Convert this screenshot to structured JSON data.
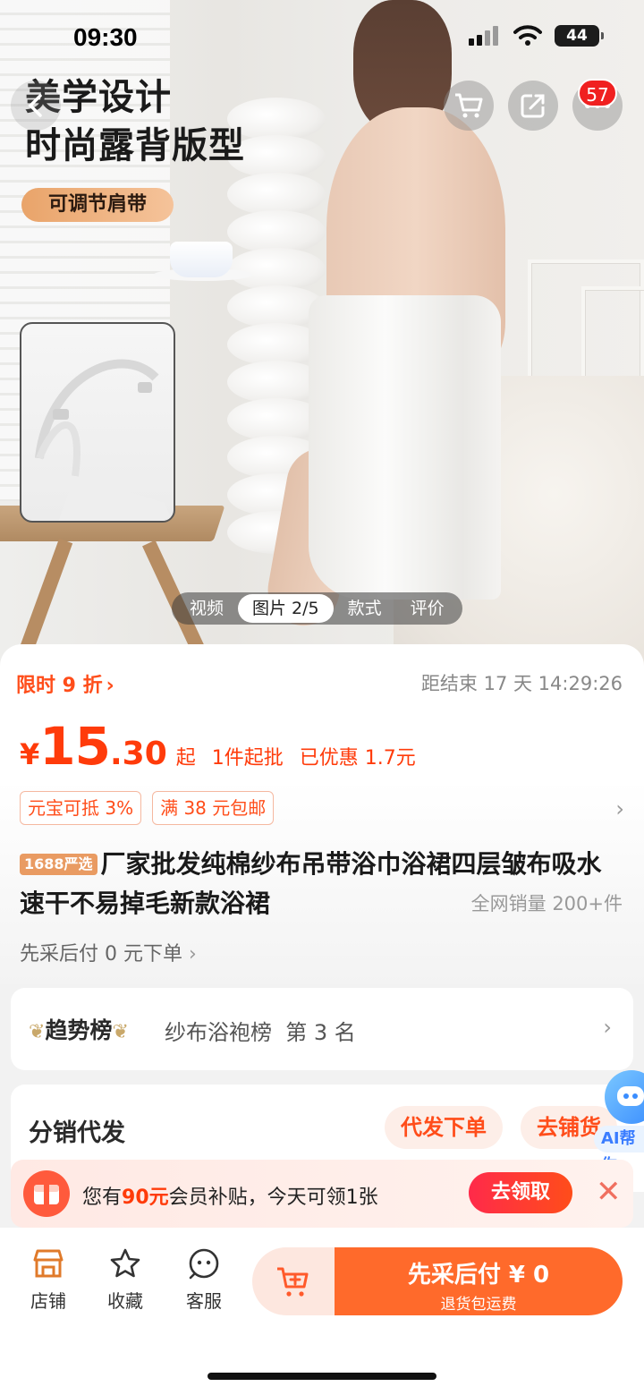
{
  "status_bar": {
    "time": "09:30",
    "battery": "44"
  },
  "hero": {
    "headline_line1": "美学设计",
    "headline_line2": "时尚露背版型",
    "tag": "可调节肩带",
    "cart_badge": "57",
    "media_tabs": [
      "视频",
      "图片 2/5",
      "款式",
      "评价"
    ],
    "active_tab_index": 1
  },
  "promo": {
    "label": "限时 9 折",
    "countdown": "距结束 17 天 14:29:26"
  },
  "price": {
    "currency": "¥",
    "integer": "15",
    "decimal": ".30",
    "suffix": "起",
    "min_order": "1件起批",
    "discount": "已优惠 1.7元"
  },
  "coupons": [
    "元宝可抵 3%",
    "满 38 元包邮"
  ],
  "product": {
    "badge": "1688严选",
    "title": "厂家批发纯棉纱布吊带浴巾浴裙四层皱布吸水速干不易掉毛新款浴裙",
    "sales": "全网销量 200+件",
    "pay_later": "先采后付 0 元下单"
  },
  "trend": {
    "title": "趋势榜",
    "text": "纱布浴袍榜  第 3 名"
  },
  "distribution": {
    "title": "分销代发",
    "btn_dropship": "代发下单",
    "btn_stock": "去铺货"
  },
  "ai_helper": {
    "label": "AI帮你"
  },
  "subsidy": {
    "prefix": "您有",
    "amount": "90元",
    "suffix": "会员补贴，今天可领1张",
    "claim": "去领取"
  },
  "bottom_nav": {
    "shop": "店铺",
    "favorite": "收藏",
    "service": "客服",
    "buy_main": "先采后付 ¥ 0",
    "buy_sub": "退货包运费"
  },
  "colors": {
    "accent": "#ff4d1a",
    "buy_button": "#ff6a2b",
    "claim_button": "#ff2a4a"
  }
}
